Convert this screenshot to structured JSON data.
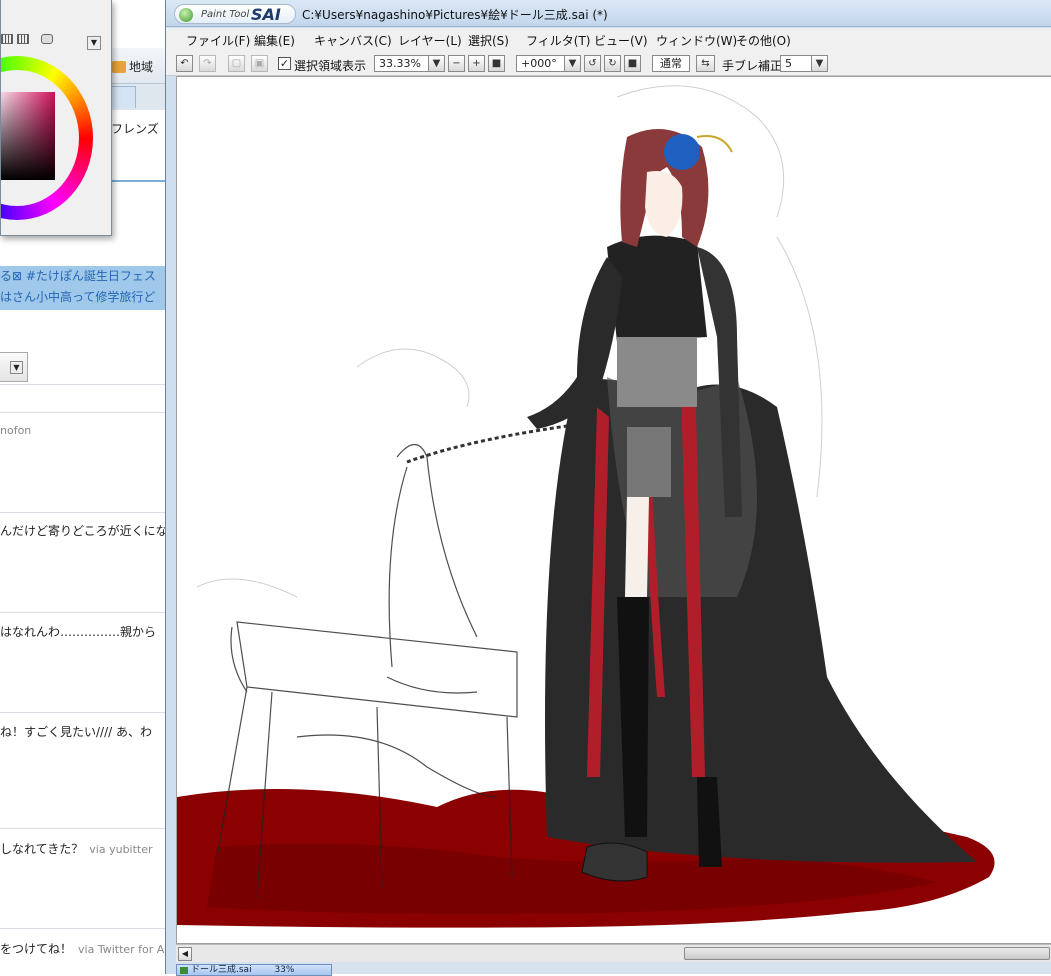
{
  "background_app": {
    "region_label": "地域",
    "friends_tab": "フレンズ",
    "highlight_lines": [
      "る⊠ #たけぽん誕生日フェス",
      "はさん小中高って修学旅行ど"
    ],
    "user_name": "nofon",
    "tweets": [
      {
        "text": "んだけど寄りどころが近くにな",
        "via": ""
      },
      {
        "text": "はなれんわ……………親から",
        "via": ""
      },
      {
        "text": "ね！すごく見たい//// あ、わ",
        "via": ""
      },
      {
        "text": "しなれてきた？",
        "via": "via yubitter"
      },
      {
        "text": "をつけてね！",
        "via": "via Twitter for A"
      }
    ]
  },
  "sai": {
    "logo_paint_tool": "Paint Tool",
    "logo_sai": "SAI",
    "window_title": "C:¥Users¥nagashino¥Pictures¥絵¥ドール三成.sai (*)",
    "menu": [
      "ファイル(F)",
      "編集(E)",
      "キャンバス(C)",
      "レイヤー(L)",
      "選択(S)",
      "フィルタ(T)",
      "ビュー(V)",
      "ウィンドウ(W)",
      "その他(O)"
    ],
    "toolbar": {
      "show_selection_label": "選択領域表示",
      "show_selection_checked": true,
      "zoom": "33.33%",
      "rotation": "+000°",
      "blend_mode": "通常",
      "stabilizer_label": "手ブレ補正",
      "stabilizer_value": "5"
    },
    "status_doc": "ドール三成.sai",
    "status_zoom": "33%"
  },
  "colors": {
    "sai_title_bg": "#c2d6ec",
    "canvas_bg": "#ffffff",
    "blood_red": "#8b0000",
    "hair": "#8a3a3a",
    "rose": "#1f5fc0"
  }
}
